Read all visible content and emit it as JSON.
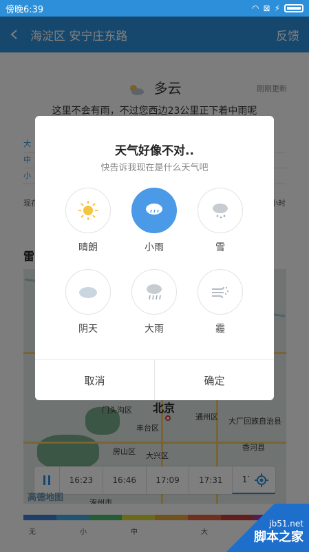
{
  "status_bar": {
    "time": "傍晚6:39"
  },
  "header": {
    "title": "海淀区 安宁庄东路",
    "feedback": "反馈"
  },
  "current": {
    "condition": "多云",
    "updated": "刚刚更新",
    "message": "这里不会有雨，不过您西边23公里正下着中雨呢"
  },
  "legend_rows": [
    "大",
    "中",
    "小"
  ],
  "now_label": "现在",
  "now_right": "小时",
  "section_title": "雷",
  "map": {
    "center_label": "北京",
    "labels": [
      "门头沟区",
      "丰台区",
      "房山区",
      "大兴区",
      "通州区",
      "大厂回族自治县",
      "香河县",
      "涿州市"
    ],
    "provider": "高德地图",
    "timeline": [
      "16:23",
      "16:46",
      "17:09",
      "17:31",
      "17:54"
    ],
    "active_time_index": 4
  },
  "intensity_scale": {
    "labels": [
      "无",
      "小",
      "中",
      "大"
    ],
    "colors": [
      "#3b7fd4",
      "#40a9e0",
      "#48b86a",
      "#d6d436",
      "#e0a43a",
      "#e0613a",
      "#c93a3a",
      "#a23fa8"
    ]
  },
  "dialog": {
    "title": "天气好像不对..",
    "subtitle": "快告诉我现在是什么天气吧",
    "options": [
      {
        "label": "晴朗",
        "icon": "sun-icon"
      },
      {
        "label": "小雨",
        "icon": "light-rain-icon",
        "selected": true
      },
      {
        "label": "雪",
        "icon": "snow-icon"
      },
      {
        "label": "阴天",
        "icon": "cloud-icon"
      },
      {
        "label": "大雨",
        "icon": "heavy-rain-icon"
      },
      {
        "label": "霾",
        "icon": "haze-icon"
      }
    ],
    "cancel": "取消",
    "confirm": "确定"
  },
  "watermark": {
    "url": "jb51.net",
    "name": "脚本之家"
  }
}
